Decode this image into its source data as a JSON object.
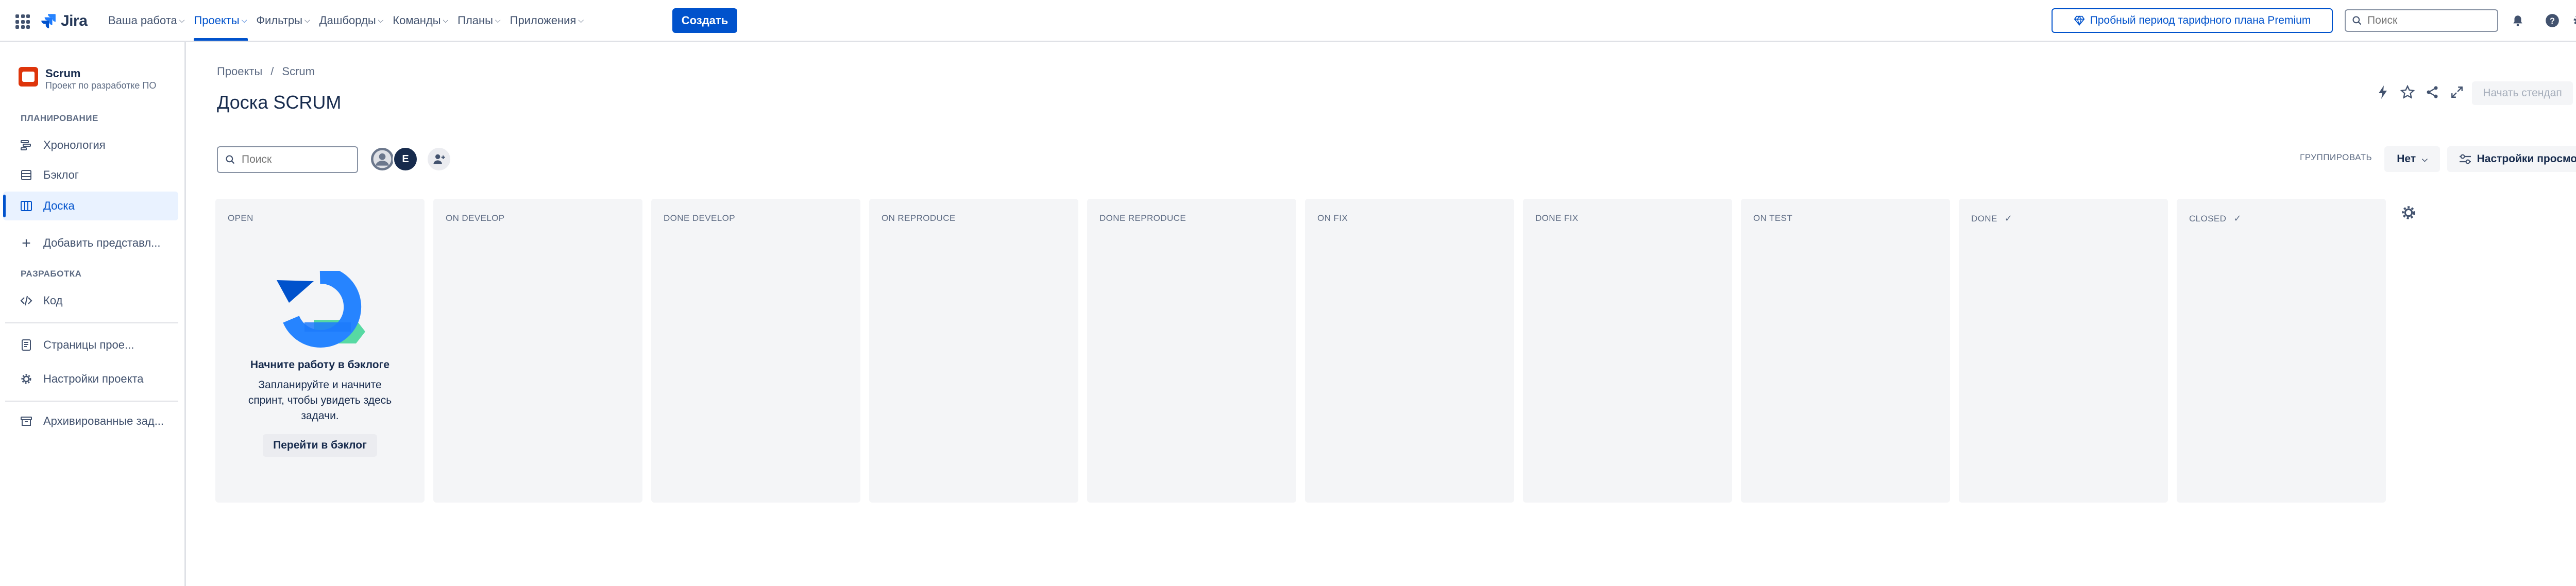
{
  "topnav": {
    "logo_text": "Jira",
    "items": [
      {
        "label": "Ваша работа",
        "active": false
      },
      {
        "label": "Проекты",
        "active": true
      },
      {
        "label": "Фильтры",
        "active": false
      },
      {
        "label": "Дашборды",
        "active": false
      },
      {
        "label": "Команды",
        "active": false
      },
      {
        "label": "Планы",
        "active": false
      },
      {
        "label": "Приложения",
        "active": false
      }
    ],
    "create_label": "Создать",
    "premium_label": "Пробный период тарифного плана Premium",
    "search_placeholder": "Поиск",
    "avatar_initial": "E"
  },
  "sidebar": {
    "project_name": "Scrum",
    "project_sub": "Проект по разработке ПО",
    "planning_title": "ПЛАНИРОВАНИЕ",
    "timeline_label": "Хронология",
    "backlog_label": "Бэклог",
    "board_label": "Доска",
    "add_view_label": "Добавить представл...",
    "dev_title": "РАЗРАБОТКА",
    "code_label": "Код",
    "pages_label": "Страницы прое...",
    "settings_label": "Настройки проекта",
    "archived_label": "Архивированные зад..."
  },
  "main": {
    "breadcrumb_1": "Проекты",
    "breadcrumb_sep": "/",
    "breadcrumb_2": "Scrum",
    "title": "Доска SCRUM",
    "standup_label": "Начать стендап",
    "more_label": "•••",
    "search_placeholder": "Поиск",
    "avatar_initial": "E",
    "group_label": "ГРУППИРОВАТЬ",
    "group_value": "Нет",
    "view_settings_label": "Настройки просмотра"
  },
  "columns": [
    {
      "title": "OPEN",
      "done": false
    },
    {
      "title": "ON DEVELOP",
      "done": false
    },
    {
      "title": "DONE DEVELOP",
      "done": false
    },
    {
      "title": "ON REPRODUCE",
      "done": false
    },
    {
      "title": "DONE REPRODUCE",
      "done": false
    },
    {
      "title": "ON FIX",
      "done": false
    },
    {
      "title": "DONE FIX",
      "done": false
    },
    {
      "title": "ON TEST",
      "done": false
    },
    {
      "title": "DONE",
      "done": true
    },
    {
      "title": "CLOSED",
      "done": true
    }
  ],
  "empty_state": {
    "heading": "Начните работу в бэклоге",
    "text": "Запланируйте и начните спринт, чтобы увидеть здесь задачи.",
    "button": "Перейти в бэклог"
  },
  "colors": {
    "accent": "#0052cc",
    "column_bg": "#f4f5f7",
    "project_icon": "#de350b"
  }
}
